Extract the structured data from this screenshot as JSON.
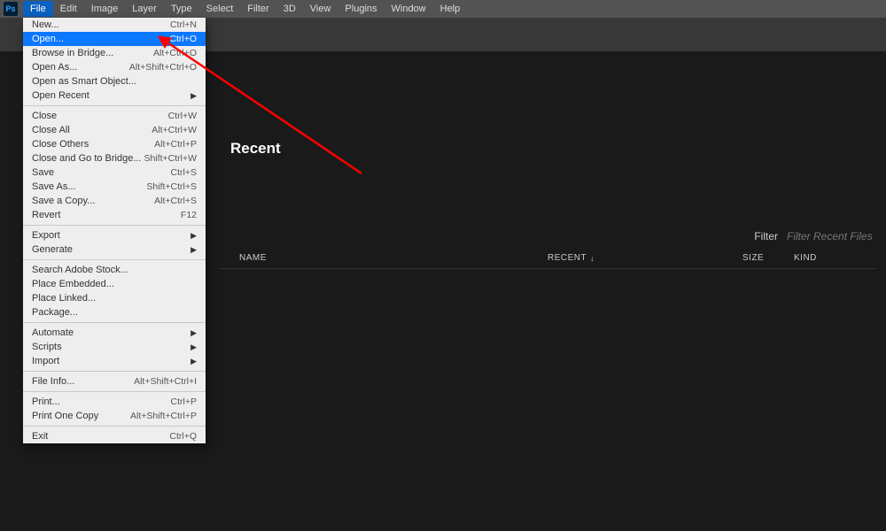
{
  "app": {
    "logo_text": "Ps"
  },
  "menubar": [
    "File",
    "Edit",
    "Image",
    "Layer",
    "Type",
    "Select",
    "Filter",
    "3D",
    "View",
    "Plugins",
    "Window",
    "Help"
  ],
  "file_menu": {
    "groups": [
      [
        {
          "label": "New...",
          "shortcut": "Ctrl+N",
          "sub": false
        },
        {
          "label": "Open...",
          "shortcut": "Ctrl+O",
          "sub": false,
          "hl": true
        },
        {
          "label": "Browse in Bridge...",
          "shortcut": "Alt+Ctrl+O",
          "sub": false
        },
        {
          "label": "Open As...",
          "shortcut": "Alt+Shift+Ctrl+O",
          "sub": false
        },
        {
          "label": "Open as Smart Object...",
          "shortcut": "",
          "sub": false
        },
        {
          "label": "Open Recent",
          "shortcut": "",
          "sub": true
        }
      ],
      [
        {
          "label": "Close",
          "shortcut": "Ctrl+W",
          "sub": false
        },
        {
          "label": "Close All",
          "shortcut": "Alt+Ctrl+W",
          "sub": false
        },
        {
          "label": "Close Others",
          "shortcut": "Alt+Ctrl+P",
          "sub": false
        },
        {
          "label": "Close and Go to Bridge...",
          "shortcut": "Shift+Ctrl+W",
          "sub": false
        },
        {
          "label": "Save",
          "shortcut": "Ctrl+S",
          "sub": false
        },
        {
          "label": "Save As...",
          "shortcut": "Shift+Ctrl+S",
          "sub": false
        },
        {
          "label": "Save a Copy...",
          "shortcut": "Alt+Ctrl+S",
          "sub": false
        },
        {
          "label": "Revert",
          "shortcut": "F12",
          "sub": false
        }
      ],
      [
        {
          "label": "Export",
          "shortcut": "",
          "sub": true
        },
        {
          "label": "Generate",
          "shortcut": "",
          "sub": true
        }
      ],
      [
        {
          "label": "Search Adobe Stock...",
          "shortcut": "",
          "sub": false
        },
        {
          "label": "Place Embedded...",
          "shortcut": "",
          "sub": false
        },
        {
          "label": "Place Linked...",
          "shortcut": "",
          "sub": false
        },
        {
          "label": "Package...",
          "shortcut": "",
          "sub": false
        }
      ],
      [
        {
          "label": "Automate",
          "shortcut": "",
          "sub": true
        },
        {
          "label": "Scripts",
          "shortcut": "",
          "sub": true
        },
        {
          "label": "Import",
          "shortcut": "",
          "sub": true
        }
      ],
      [
        {
          "label": "File Info...",
          "shortcut": "Alt+Shift+Ctrl+I",
          "sub": false
        }
      ],
      [
        {
          "label": "Print...",
          "shortcut": "Ctrl+P",
          "sub": false
        },
        {
          "label": "Print One Copy",
          "shortcut": "Alt+Shift+Ctrl+P",
          "sub": false
        }
      ],
      [
        {
          "label": "Exit",
          "shortcut": "Ctrl+Q",
          "sub": false
        }
      ]
    ]
  },
  "home": {
    "recent_title": "Recent",
    "filter_label": "Filter",
    "filter_placeholder": "Filter Recent Files",
    "columns": {
      "name": "NAME",
      "recent": "RECENT",
      "size": "SIZE",
      "kind": "KIND"
    }
  }
}
